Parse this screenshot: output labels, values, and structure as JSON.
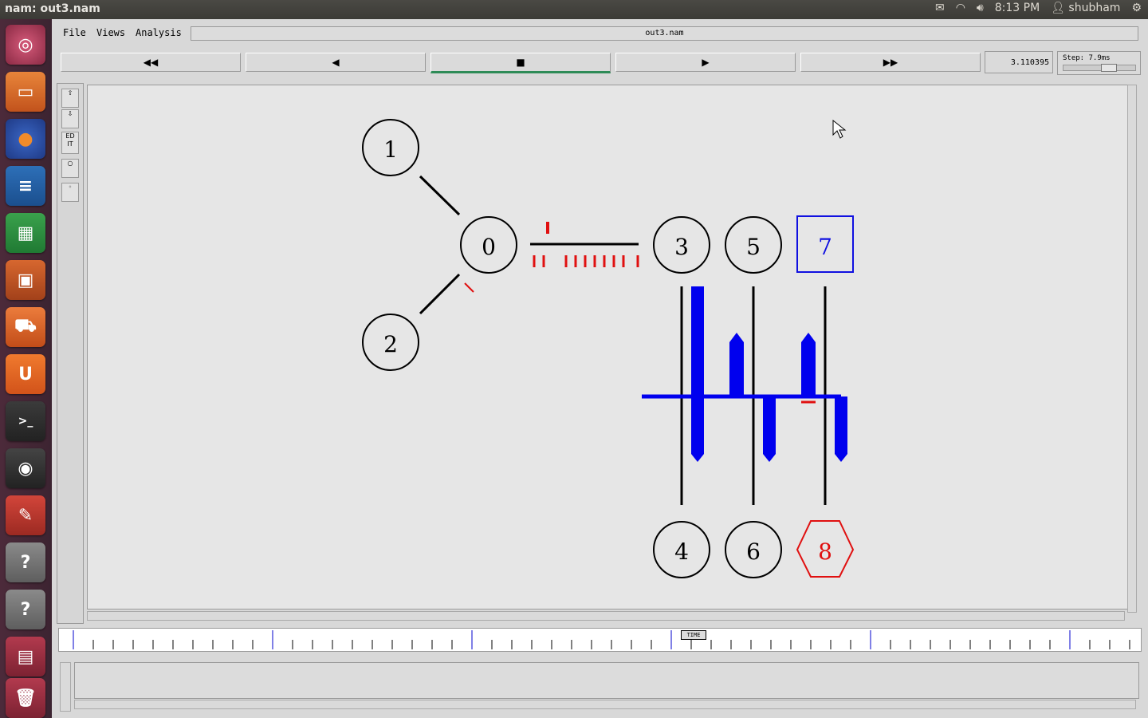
{
  "topbar": {
    "window_title": "nam: out3.nam",
    "time": "8:13 PM",
    "user": "shubham",
    "icons": [
      "mail-icon",
      "wifi-icon",
      "volume-icon",
      "user-icon",
      "gear-icon"
    ]
  },
  "launcher": {
    "items": [
      "dash-icon",
      "files-icon",
      "firefox-icon",
      "writer-icon",
      "calc-icon",
      "impress-icon",
      "software-center-icon",
      "ubuntu-one-icon",
      "terminal-icon",
      "screenshot-icon",
      "settings-icon",
      "help-icon",
      "help-icon",
      "workspaces-icon",
      "trash-icon"
    ]
  },
  "menubar": {
    "file": "File",
    "views": "Views",
    "analysis": "Analysis",
    "filename": "out3.nam"
  },
  "controls": {
    "rewind": "◀◀",
    "back": "◀",
    "stop": "■",
    "play": "▶",
    "fastforward": "▶▶",
    "time_value": "3.110395",
    "step_label": "Step: 7.9ms"
  },
  "tools": {
    "edit_label": "ED IT"
  },
  "nodes": [
    {
      "id": "1",
      "shape": "circle",
      "color": "#000000"
    },
    {
      "id": "0",
      "shape": "circle",
      "color": "#000000"
    },
    {
      "id": "2",
      "shape": "circle",
      "color": "#000000"
    },
    {
      "id": "3",
      "shape": "circle",
      "color": "#000000"
    },
    {
      "id": "5",
      "shape": "circle",
      "color": "#000000"
    },
    {
      "id": "7",
      "shape": "square",
      "color": "#1010e0"
    },
    {
      "id": "4",
      "shape": "circle",
      "color": "#000000"
    },
    {
      "id": "6",
      "shape": "circle",
      "color": "#000000"
    },
    {
      "id": "8",
      "shape": "hexagon",
      "color": "#e01010"
    }
  ],
  "timeline": {
    "label": "TIME"
  },
  "colors": {
    "packet_red": "#e01010",
    "lan_blue": "#0000ee",
    "progress_green": "#2e8b57"
  }
}
